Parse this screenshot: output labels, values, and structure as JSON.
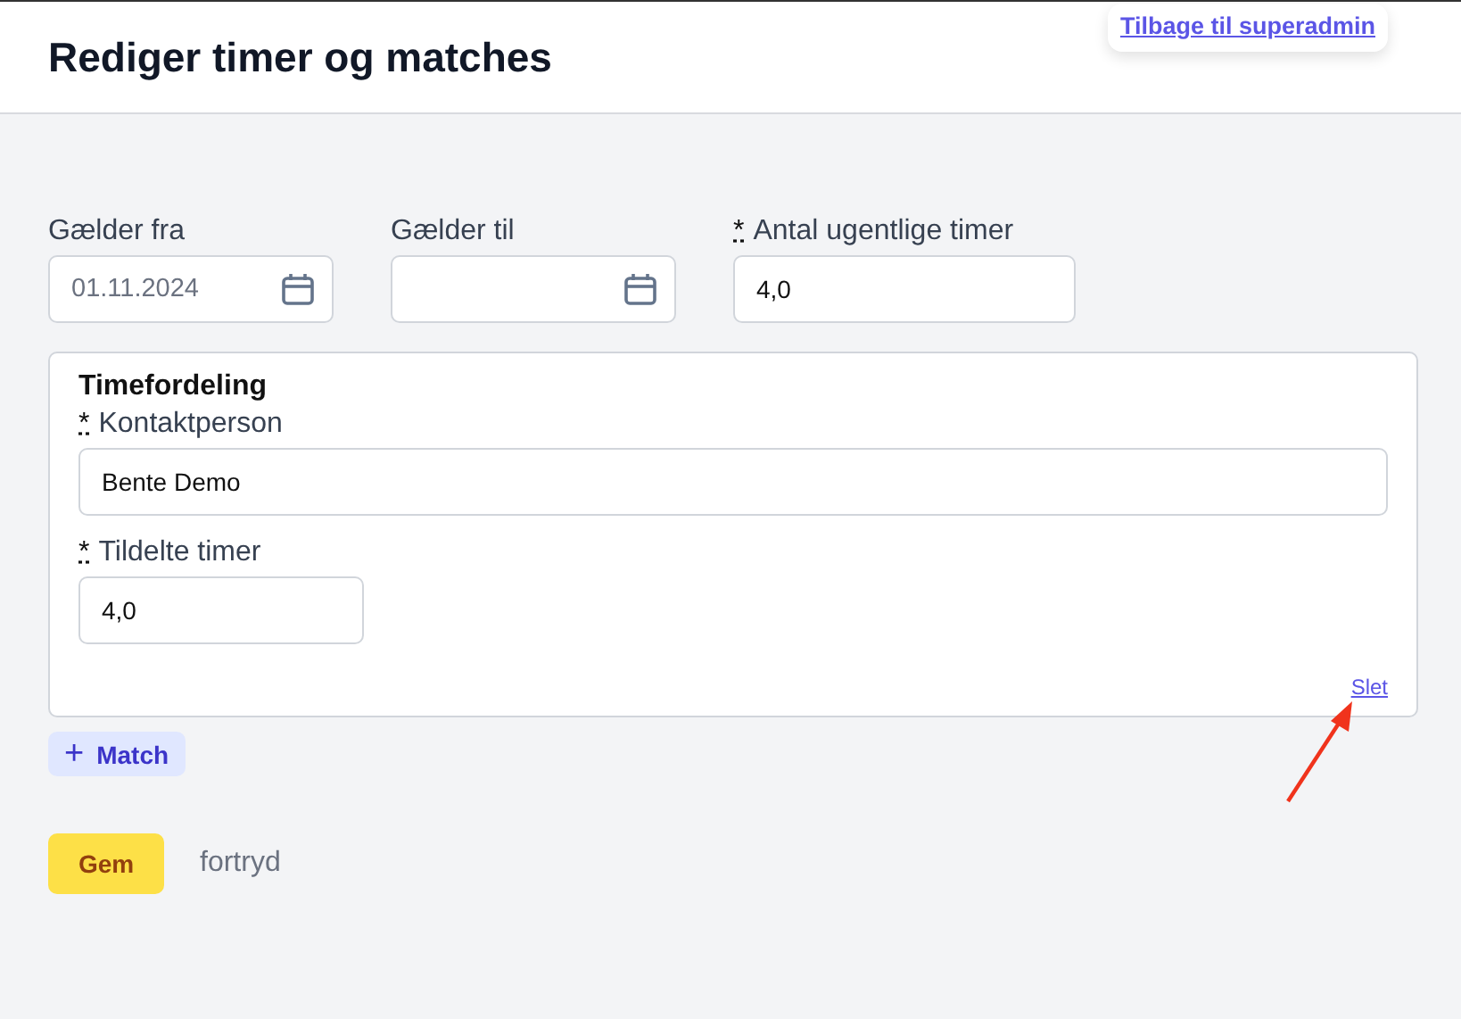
{
  "header": {
    "title": "Rediger timer og matches",
    "back_link": "Tilbage til superadmin"
  },
  "fields": [
    {
      "kind": "date",
      "label": "Gælder fra",
      "value": "01.11.2024"
    },
    {
      "kind": "date",
      "label": "Gælder til"
    },
    {
      "kind": "number",
      "label": "Antal ugentlige timer",
      "required_mark": "*",
      "value": "4,0"
    }
  ],
  "distribution": {
    "title": "Timefordeling",
    "fields": [
      {
        "kind": "wide",
        "label": "Kontaktperson",
        "required_mark": "*",
        "value": "Bente Demo"
      },
      {
        "kind": "narrow",
        "label": "Tildelte timer",
        "required_mark": "*",
        "value": "4,0"
      }
    ],
    "delete_link": "Slet"
  },
  "add_match": {
    "icon": "+",
    "label": "Match"
  },
  "actions": {
    "save": "Gem",
    "cancel": "fortryd"
  }
}
